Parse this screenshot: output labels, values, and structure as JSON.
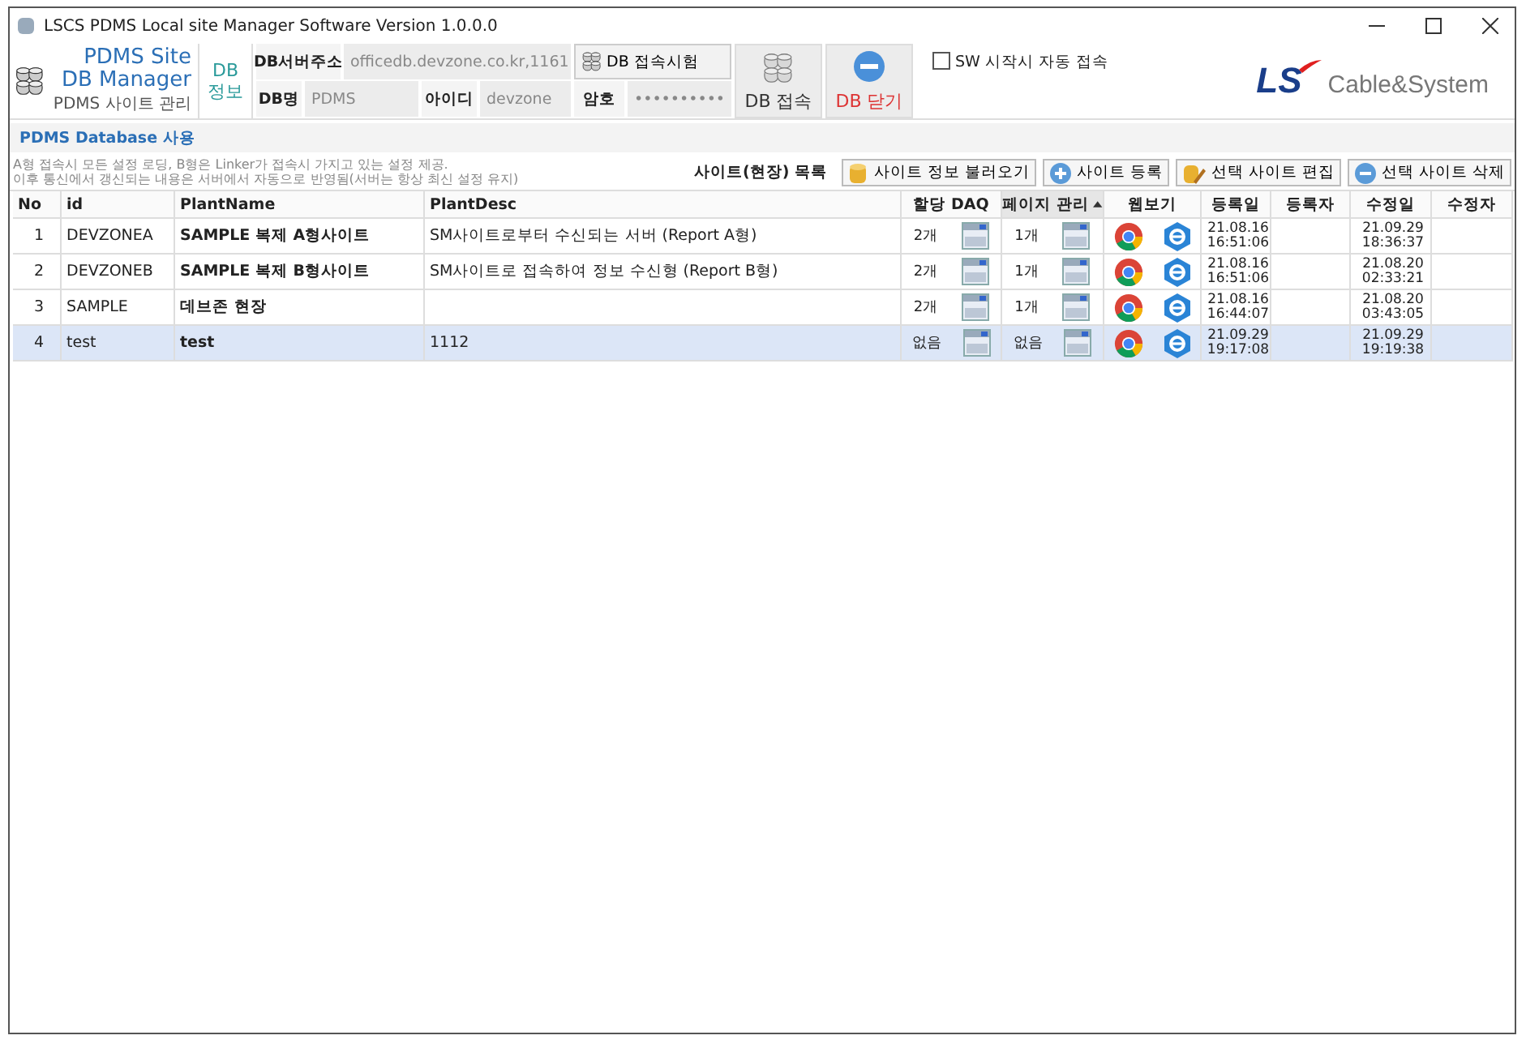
{
  "window": {
    "title": "LSCS PDMS Local site Manager Software Version 1.0.0.0"
  },
  "app_logo": {
    "title_line_1": "PDMS Site",
    "title_line_2": "DB Manager",
    "subtitle": "PDMS 사이트 관리"
  },
  "db_info_label": "DB 정보",
  "connection": {
    "server_label": "DB서버주소",
    "server": "officedb.devzone.co.kr,1161",
    "test_button": "DB 접속시험",
    "db_label": "DB명",
    "db": "PDMS",
    "id_label": "아이디",
    "id": "devzone",
    "password_label": "암호",
    "password": "••••••••••"
  },
  "connect_button": "DB 접속",
  "close_button": "DB 닫기",
  "auto_connect": {
    "label": "SW 시작시 자동 접속",
    "checked": false
  },
  "brand": {
    "mark": "LS",
    "name": "Cable&System"
  },
  "section_title": "PDMS Database 사용",
  "notes": [
    "A형 접속시 모든 설정 로딩, B형은 Linker가 접속시 가지고 있는 설정 제공.",
    "이후 통신에서 갱신되는 내용은 서버에서 자동으로 반영됨(서버는 항상 최신 설정 유지)"
  ],
  "list_title": "사이트(현장) 목록",
  "actions": [
    {
      "label": "사이트 정보 불러오기",
      "kind": "load"
    },
    {
      "label": "사이트 등록",
      "kind": "add"
    },
    {
      "label": "선택 사이트 편집",
      "kind": "edit"
    },
    {
      "label": "선택 사이트 삭제",
      "kind": "delete"
    }
  ],
  "table": {
    "columns": [
      {
        "label": "No",
        "sorted": false
      },
      {
        "label": "id",
        "sorted": false
      },
      {
        "label": "PlantName",
        "sorted": false
      },
      {
        "label": "PlantDesc",
        "sorted": false
      },
      {
        "label": "할당 DAQ",
        "sorted": false
      },
      {
        "label": "페이지 관리",
        "sorted": true
      },
      {
        "label": "웹보기",
        "sorted": false
      },
      {
        "label": "등록일",
        "sorted": false
      },
      {
        "label": "등록자",
        "sorted": false
      },
      {
        "label": "수정일",
        "sorted": false
      },
      {
        "label": "수정자",
        "sorted": false
      }
    ],
    "rows": [
      {
        "no": "1",
        "id": "DEVZONEA",
        "plant_name": "SAMPLE 복제 A형사이트",
        "plant_desc": "SM사이트로부터 수신되는 서버 (Report A형)",
        "daq": "2개",
        "pages": "1개",
        "registered_date": "21.08.16",
        "registered_time": "16:51:06",
        "modified_date": "21.09.29",
        "modified_time": "18:36:37",
        "selected": false
      },
      {
        "no": "2",
        "id": "DEVZONEB",
        "plant_name": "SAMPLE 복제 B형사이트",
        "plant_desc": "SM사이트로 접속하여 정보 수신형 (Report B형)",
        "daq": "2개",
        "pages": "1개",
        "registered_date": "21.08.16",
        "registered_time": "16:51:06",
        "modified_date": "21.08.20",
        "modified_time": "02:33:21",
        "selected": false
      },
      {
        "no": "3",
        "id": "SAMPLE",
        "plant_name": "데브존 현장",
        "daq": "2개",
        "pages": "1개",
        "registered_date": "21.08.16",
        "registered_time": "16:44:07",
        "modified_date": "21.08.20",
        "modified_time": "03:43:05",
        "selected": false
      },
      {
        "no": "4",
        "id": "test",
        "plant_name": "test",
        "plant_desc": "1112",
        "daq": "없음",
        "pages": "없음",
        "registered_date": "21.09.29",
        "registered_time": "19:17:08",
        "modified_date": "21.09.29",
        "modified_time": "19:19:38",
        "selected": true
      }
    ]
  }
}
